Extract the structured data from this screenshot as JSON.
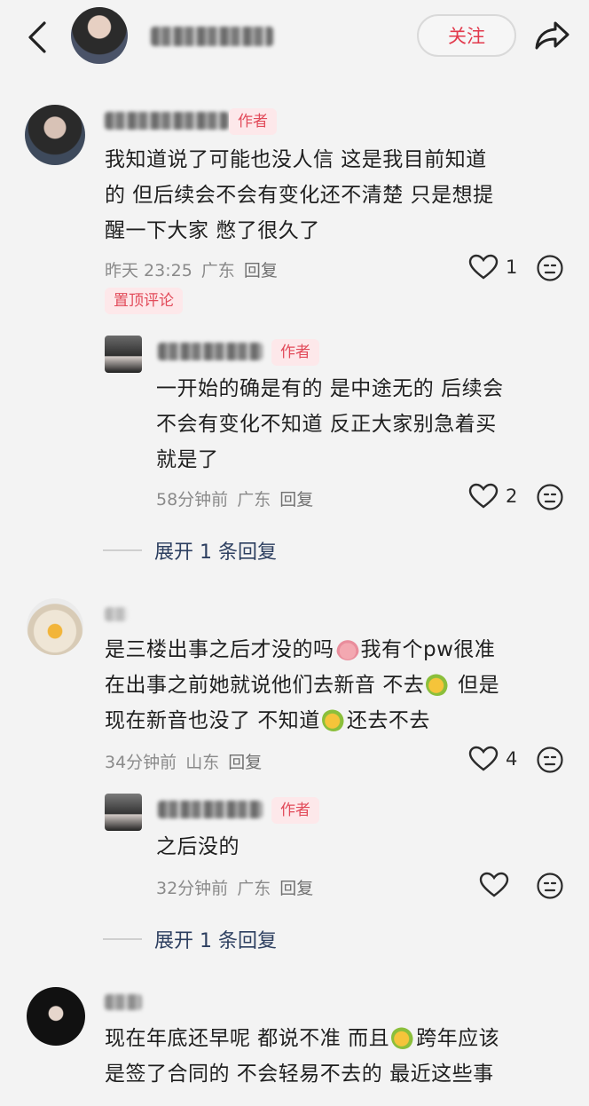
{
  "header": {
    "follow_label": "关注"
  },
  "comments": [
    {
      "author_tag": "作者",
      "lines": [
        "我知道说了可能也没人信 这是我目前知道",
        "的 但后续会不会有变化还不清楚 只是想提",
        "醒一下大家 憋了很久了"
      ],
      "time": "昨天 23:25",
      "location": "广东",
      "reply_label": "回复",
      "likes": "1",
      "pin_label": "置顶评论",
      "replies": [
        {
          "author_tag": "作者",
          "lines": [
            "一开始的确是有的 是中途无的 后续会",
            "不会有变化不知道 反正大家别急着买",
            "就是了"
          ],
          "time": "58分钟前",
          "location": "广东",
          "reply_label": "回复",
          "likes": "2"
        }
      ],
      "expand_label": "展开 1 条回复"
    },
    {
      "lines_a": [
        "是三楼出事之后才没的吗",
        "我有个pw很准"
      ],
      "line2_a": "在出事之前她就说他们去新音 不去",
      "line2_b": " 但是",
      "line3_a": "现在新音也没了 不知道",
      "line3_b": "还去不去",
      "time": "34分钟前",
      "location": "山东",
      "reply_label": "回复",
      "likes": "4",
      "replies": [
        {
          "author_tag": "作者",
          "lines": [
            "之后没的"
          ],
          "time": "32分钟前",
          "location": "广东",
          "reply_label": "回复"
        }
      ],
      "expand_label": "展开 1 条回复"
    },
    {
      "line1_a": "现在年底还早呢 都说不准 而且",
      "line1_b": "跨年应该",
      "line2": "是签了合同的 不会轻易不去的 最近这些事"
    }
  ]
}
